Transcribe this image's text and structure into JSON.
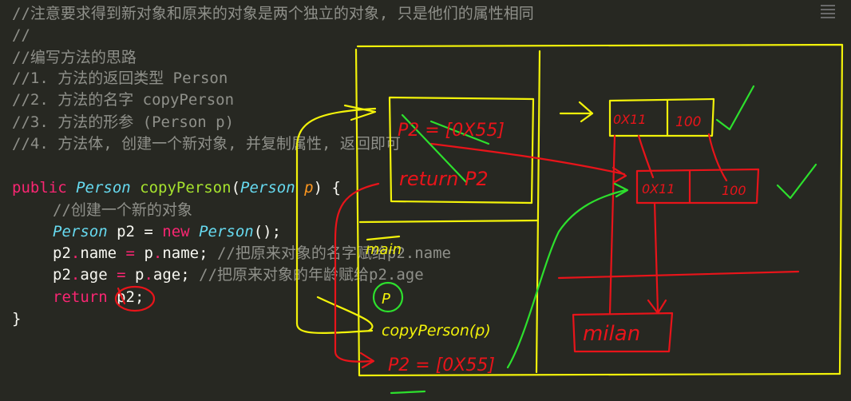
{
  "code": {
    "comment_1": "//注意要求得到新对象和原来的对象是两个独立的对象, 只是他们的属性相同",
    "comment_2": "//",
    "comment_3": "//编写方法的思路",
    "comment_4": "//1. 方法的返回类型 Person",
    "comment_5": "//2. 方法的名字 copyPerson",
    "comment_6": "//3. 方法的形参 (Person p)",
    "comment_7": "//4. 方法体, 创建一个新对象, 并复制属性, 返回即可",
    "sig": {
      "public": "public ",
      "type": "Person",
      "space": " ",
      "method": "copyPerson",
      "open": "(",
      "ptype": "Person",
      "space2": " ",
      "pname": "p",
      "close": ") {"
    },
    "body_comment": "//创建一个新的对象",
    "line_new": {
      "type": "Person",
      "mid": " p2 = ",
      "kw": "new",
      "space": " ",
      "ctor": "Person",
      "end": "();"
    },
    "line_name": {
      "p2": "p2",
      "dot1": ".",
      "field": "name",
      "eq": " = ",
      "p": "p",
      "dot2": ".",
      "field2": "name",
      "semi": "; ",
      "comment": "//把原来对象的名字赋给p2.name"
    },
    "line_age": {
      "p2": "p2",
      "dot1": ".",
      "field": "age",
      "eq": " = ",
      "p": "p",
      "dot2": ".",
      "field2": "age",
      "semi": "; ",
      "comment": "//把原来对象的年龄赋给p2.age"
    },
    "line_return": {
      "kw": "return",
      "space": " ",
      "val": "p2;"
    },
    "close_brace": "}"
  },
  "annotations": {
    "frame_stack_top": "P2 = [0X55]",
    "frame_return": "return P2",
    "frame_main": "main",
    "frame_p": "P",
    "frame_copy": "copyPerson(p)",
    "frame_p2": "P2 = [0X55]",
    "heap_obj1_addr": "0X11",
    "heap_obj1_age": "100",
    "heap_obj2_addr": "0X11",
    "heap_obj2_age": "100",
    "string_value": "milan"
  },
  "colors": {
    "background": "#272822",
    "comment": "#8f908a",
    "keyword": "#f92672",
    "type": "#66d9ef",
    "function": "#a6e22e",
    "param": "#fd971f",
    "ink_yellow": "#f2f20a",
    "ink_red": "#e8141a",
    "ink_green": "#2de02d"
  }
}
